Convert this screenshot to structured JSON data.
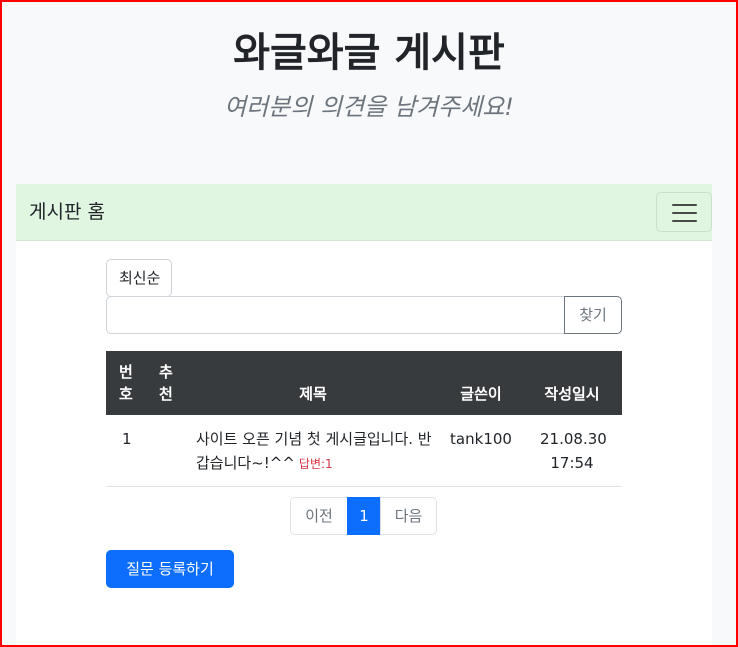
{
  "header": {
    "title": "와글와글 게시판",
    "subtitle": "여러분의 의견을 남겨주세요!"
  },
  "navbar": {
    "brand": "게시판 홈",
    "toggler_icon": "hamburger-icon"
  },
  "search": {
    "sort_value": "최신순",
    "input_value": "",
    "button_label": "찾기"
  },
  "table": {
    "headers": {
      "num": "번호",
      "rec": "추천",
      "title": "제목",
      "author": "글쓴이",
      "date": "작성일시"
    },
    "rows": [
      {
        "num": "1",
        "rec": "",
        "title": "사이트 오픈 기념 첫 게시글입니다. 반갑습니다~!^^",
        "answers": "답변:1",
        "author": "tank100",
        "date": "21.08.30 17:54"
      }
    ]
  },
  "pagination": {
    "prev": "이전",
    "current": "1",
    "next": "다음"
  },
  "actions": {
    "ask_label": "질문 등록하기"
  },
  "colors": {
    "navbar_bg": "#e1f6e1",
    "primary": "#0d6efd",
    "table_header_bg": "#373b3e",
    "badge_red": "#dc3545",
    "frame_border": "#ff0000"
  }
}
